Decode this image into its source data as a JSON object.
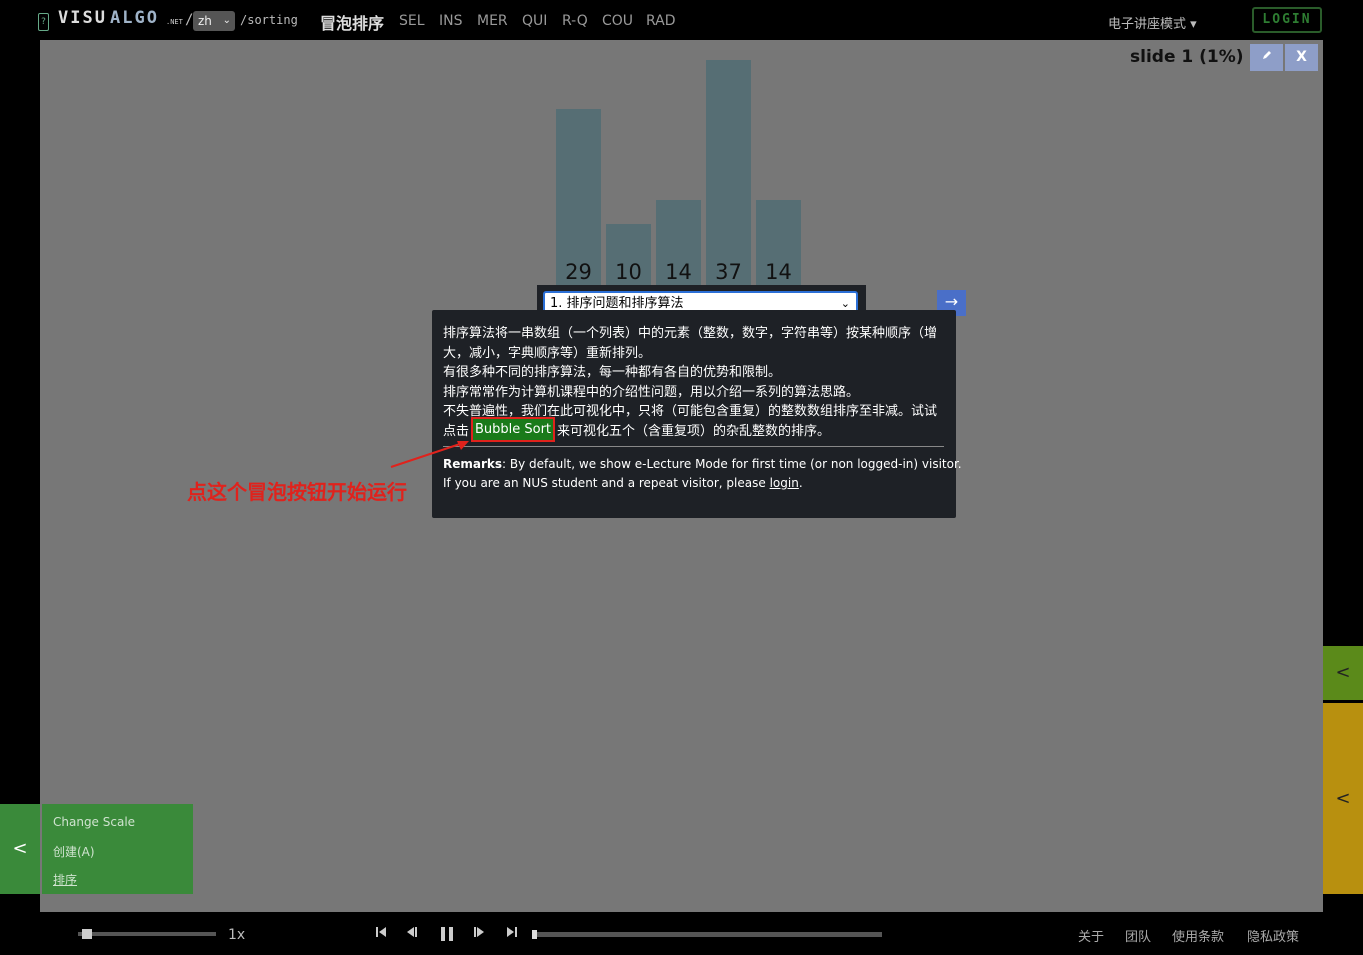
{
  "header": {
    "logo_q": "?",
    "logo_visu": "VISU",
    "logo_algo": "ALGO",
    "logo_net": ".NET",
    "slash": "/",
    "language": "zh",
    "path": "/sorting",
    "algo_title": "冒泡排序",
    "algo_tabs": [
      "SEL",
      "INS",
      "MER",
      "QUI",
      "R-Q",
      "COU",
      "RAD"
    ],
    "mode_label": "电子讲座模式 ▾",
    "login_label": "LOGIN"
  },
  "stage": {
    "slide_info": "slide 1 (1%)",
    "minimize_icon": "pen-icon",
    "close_label": "X"
  },
  "bars": {
    "values": [
      29,
      10,
      14,
      37,
      14
    ],
    "labels": [
      "29",
      "10",
      "14",
      "37",
      "14"
    ]
  },
  "lecture": {
    "slide_select": "1. 排序问题和排序算法",
    "next_arrow": "→",
    "line1": "排序算法将一串数组（一个列表）中的元素（整数，数字，字符串等）按某种顺序（增",
    "line2": "大，减小，字典顺序等）重新排列。",
    "line3": "有很多种不同的排序算法，每一种都有各自的优势和限制。",
    "line4": "排序常常作为计算机课程中的介绍性问题，用以介绍一系列的算法思路。",
    "line5": "不失普遍性，我们在此可视化中，只将（可能包含重复）的整数数组排序至非减。试试",
    "line6_pre": "点击",
    "bubble_sort": "Bubble Sort",
    "line6_post": "来可视化五个（含重复项）的杂乱整数的排序。",
    "remarks_label": "Remarks",
    "remarks_text": ": By default, we show e-Lecture Mode for first time (or non logged-in) visitor.",
    "remarks_line2": "If you are an NUS student and a repeat visitor, please",
    "login_link": "login",
    "remarks_end": "."
  },
  "annotation": "点这个冒泡按钮开始运行",
  "side_tabs": {
    "upper": "<",
    "lower": "<"
  },
  "left_panel": {
    "toggle": "<",
    "items": [
      "Change Scale",
      "创建(A)",
      "排序"
    ]
  },
  "playback": {
    "speed": "1x",
    "speed_fraction": 0.03,
    "progress_fraction": 0.0
  },
  "footer": [
    "关于",
    "团队",
    "使用条款",
    "隐私政策"
  ],
  "colors": {
    "stage_bg": "#777777",
    "bar_color": "#566e74",
    "bubble_button": "#1a7a1a",
    "annotation_red": "#e0221c",
    "side_green": "#5b8a1a",
    "side_gold": "#b8900f",
    "next_button": "#4a6fc8"
  }
}
